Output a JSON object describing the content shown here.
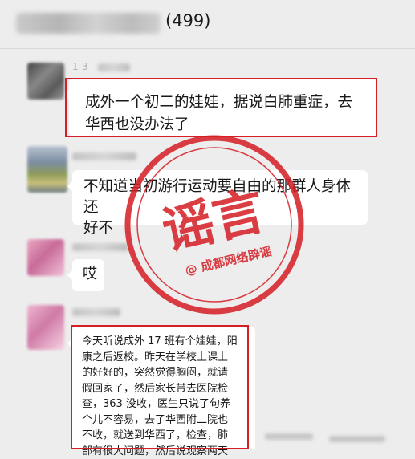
{
  "header": {
    "title_count": "(499)"
  },
  "messages": [
    {
      "sender_time": "1-3-",
      "text": "成外一个初二的娃娃，据说白肺重症，去华西也没办法了"
    },
    {
      "text_line1": "不知道当初游行运动要自由的那群人身体还",
      "text_line2": "好不"
    },
    {
      "text": "哎"
    },
    {
      "lines": [
        "今天听说成外 17 班有个娃娃，阳",
        "康之后返校。昨天在学校上课上",
        "的好好的，突然觉得胸闷，就请",
        "假回家了，然后家长带去医院检",
        "查，363 没收，医生只说了句养",
        "个儿不容易，去了华西附二院也",
        "不收，就送到华西了，检查，肺",
        "部有很大问题，然后说观察两天"
      ]
    }
  ],
  "stamp": {
    "main": "谣言",
    "sub": "@ 成都网络辟谣"
  },
  "colors": {
    "stamp_red": "#d51f25",
    "bubble": "#ffffff",
    "background": "#ededed"
  }
}
